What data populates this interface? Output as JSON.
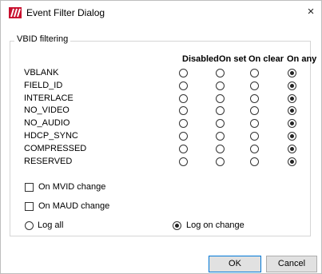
{
  "window": {
    "title": "Event Filter Dialog",
    "close_glyph": "×"
  },
  "group": {
    "title": "VBID filtering"
  },
  "columns": [
    "Disabled",
    "On set",
    "On clear",
    "On any"
  ],
  "rows": [
    {
      "label": "VBLANK",
      "selected": 3
    },
    {
      "label": "FIELD_ID",
      "selected": 3
    },
    {
      "label": "INTERLACE",
      "selected": 3
    },
    {
      "label": "NO_VIDEO",
      "selected": 3
    },
    {
      "label": "NO_AUDIO",
      "selected": 3
    },
    {
      "label": "HDCP_SYNC",
      "selected": 3
    },
    {
      "label": "COMPRESSED",
      "selected": 3
    },
    {
      "label": "RESERVED",
      "selected": 3
    }
  ],
  "checkboxes": [
    {
      "label": "On MVID change",
      "checked": false
    },
    {
      "label": "On MAUD change",
      "checked": false
    }
  ],
  "log_options": [
    {
      "label": "Log all",
      "selected": false
    },
    {
      "label": "Log on change",
      "selected": true
    }
  ],
  "buttons": {
    "ok": "OK",
    "cancel": "Cancel"
  }
}
